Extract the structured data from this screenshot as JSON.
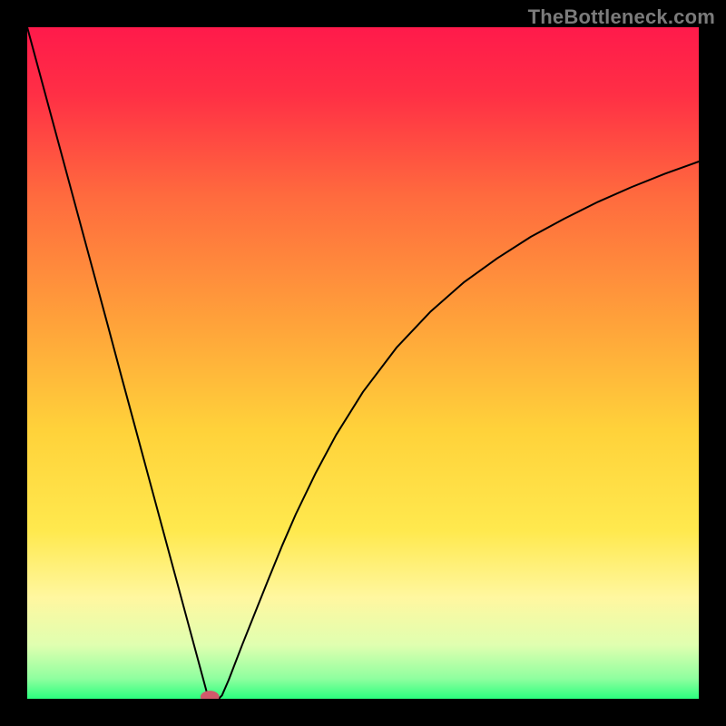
{
  "watermark": "TheBottleneck.com",
  "chart_data": {
    "type": "line",
    "title": "",
    "xlabel": "",
    "ylabel": "",
    "xlim": [
      0,
      100
    ],
    "ylim": [
      0,
      100
    ],
    "background_gradient": {
      "stops": [
        {
          "offset": 0.0,
          "color": "#ff1a4b"
        },
        {
          "offset": 0.1,
          "color": "#ff2f45"
        },
        {
          "offset": 0.25,
          "color": "#ff6a3e"
        },
        {
          "offset": 0.45,
          "color": "#ffa53a"
        },
        {
          "offset": 0.6,
          "color": "#ffd23a"
        },
        {
          "offset": 0.75,
          "color": "#ffe94e"
        },
        {
          "offset": 0.85,
          "color": "#fff7a0"
        },
        {
          "offset": 0.92,
          "color": "#e0ffb0"
        },
        {
          "offset": 0.97,
          "color": "#8fff9f"
        },
        {
          "offset": 1.0,
          "color": "#2bff7e"
        }
      ]
    },
    "series": [
      {
        "name": "bottleneck-curve",
        "color": "#000000",
        "stroke_width": 2,
        "x": [
          0,
          2,
          4,
          6,
          8,
          10,
          12,
          14,
          16,
          18,
          20,
          22,
          24,
          26,
          27,
          28,
          28.5,
          29,
          30,
          32,
          34,
          36,
          38,
          40,
          43,
          46,
          50,
          55,
          60,
          65,
          70,
          75,
          80,
          85,
          90,
          95,
          100
        ],
        "y": [
          100,
          92.6,
          85.2,
          77.8,
          70.4,
          63.0,
          55.6,
          48.1,
          40.7,
          33.3,
          25.9,
          18.5,
          11.1,
          3.7,
          0.0,
          0.0,
          0.0,
          0.5,
          2.8,
          8.0,
          13.0,
          18.0,
          22.9,
          27.5,
          33.7,
          39.3,
          45.7,
          52.3,
          57.6,
          62.0,
          65.6,
          68.8,
          71.5,
          74.0,
          76.2,
          78.2,
          80.0
        ]
      }
    ],
    "marker": {
      "x": 27.2,
      "y": 0.3,
      "rx": 1.4,
      "ry": 0.9,
      "color": "#d15a6b"
    }
  }
}
